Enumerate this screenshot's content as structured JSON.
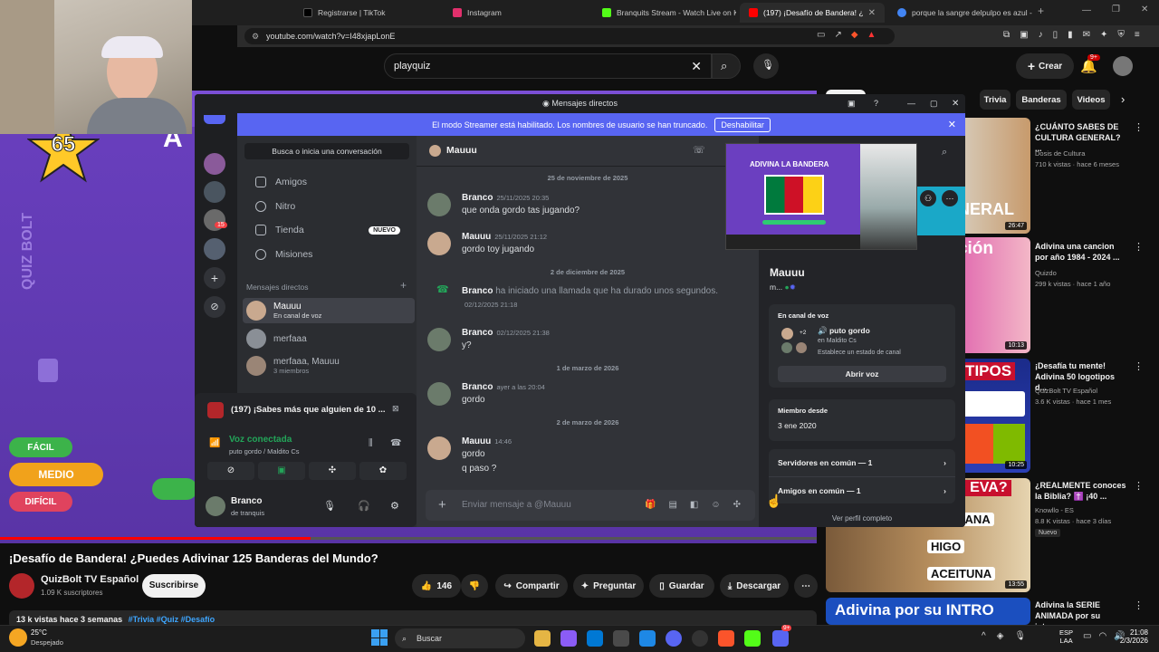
{
  "browser": {
    "tabs": [
      {
        "label": "Registrarse | TikTok",
        "color": "#000000"
      },
      {
        "label": "Instagram",
        "color": "#e1306c"
      },
      {
        "label": "Branquits Stream - Watch Live on Ki",
        "color": "#53fc18"
      },
      {
        "label": "(197) ¡Desafío de Bandera! ¿Pue",
        "color": "#ff0000"
      },
      {
        "label": "porque la sangre delpulpo es azul -",
        "color": "#4285f4"
      }
    ],
    "url": "youtube.com/watch?v=I48xjapLonE"
  },
  "youtube": {
    "search_value": "playquiz",
    "create_label": "Crear",
    "notif_count": "9+",
    "video": {
      "score": "65",
      "brand": "QUIZ BOLT",
      "buttons": [
        "FÁCIL",
        "MEDIO",
        "DIFÍCIL"
      ]
    },
    "title": "¡Desafío de Bandera! ¿Puedes Adivinar 125 Banderas del Mundo?",
    "channel": "QuizBolt TV Español",
    "subscribers": "1.09 K suscriptores",
    "subscribe_label": "Suscribirse",
    "likes": "146",
    "share_label": "Compartir",
    "ask_label": "Preguntar",
    "save_label": "Guardar",
    "download_label": "Descargar",
    "description_meta": "13 k vistas  hace 3 semanas",
    "description_tags": "#Trivia #Quiz #Desafío",
    "chips": [
      "Trivia",
      "Banderas",
      "Videos"
    ],
    "recommendations": [
      {
        "title": "¿CUÁNTO SABES DE CULTURA GENERAL? ...",
        "channel": "Dosis de Cultura",
        "meta": "710 k vistas · hace 6 meses",
        "duration": "26:47",
        "thumb_text": "S GENERAL"
      },
      {
        "title": "Adivina una cancion por año 1984 - 2024 ...",
        "channel": "Quizdo",
        "meta": "299 k vistas · hace 1 año",
        "duration": "10:13",
        "thumb_text": "Canción"
      },
      {
        "title": "¡Desafía tu mente! Adivina 50 logotipos d...",
        "channel": "QuizBolt TV Español",
        "meta": "3.6 K vistas · hace 1 mes",
        "duration": "10:25",
        "thumb_text": "LOGOTIPOS"
      },
      {
        "title": "¿REALMENTE conoces la Biblia? ✝️ ¡40 ...",
        "channel": "Knowllo - ES",
        "meta": "8.8 K vistas · hace 3 días",
        "duration": "13:55",
        "badge": "Nuevo",
        "thumb_text": "¿QUIÓ EVA?",
        "options": [
          "MANZANA",
          "HIGO",
          "ACEITUNA"
        ]
      },
      {
        "title": "Adivina la SERIE ANIMADA por su intro...",
        "channel": "",
        "meta": "",
        "duration": "",
        "thumb_text": "Adivina por su INTRO"
      }
    ]
  },
  "discord": {
    "window_title": "Mensajes directos",
    "banner_text": "El modo Streamer está habilitado. Los nombres de usuario se han truncado.",
    "banner_button": "Deshabilitar",
    "search_placeholder": "Busca o inicia una conversación",
    "nav": [
      "Amigos",
      "Nitro",
      "Tienda",
      "Misiones"
    ],
    "new_badge": "NUEVO",
    "dm_header": "Mensajes directos",
    "server_badge": "15",
    "dms": [
      {
        "name": "Mauuu",
        "status": "En canal de voz"
      },
      {
        "name": "merfaaa",
        "status": ""
      },
      {
        "name": "merfaaa, Mauuu",
        "status": "3 miembros"
      }
    ],
    "voice_panel": {
      "activity": "(197) ¡Sabes más que alguien de 10 ...",
      "status": "Voz conectada",
      "channel": "puto gordo / Maldito Cs"
    },
    "user": {
      "name": "Branco",
      "status": "de tranquis"
    },
    "chat": {
      "recipient": "Mauuu",
      "input_placeholder": "Enviar mensaje a @Mauuu",
      "dividers": [
        "25 de noviembre de 2025",
        "2 de diciembre de 2025",
        "1 de marzo de 2026",
        "2 de marzo de 2026"
      ],
      "messages": [
        {
          "author": "Branco",
          "time": "25/11/2025 20:35",
          "lines": [
            "que onda gordo tas jugando?"
          ]
        },
        {
          "author": "Mauuu",
          "time": "25/11/2025 21:12",
          "lines": [
            "gordo toy jugando"
          ]
        },
        {
          "author": "Branco",
          "call_text": "ha iniciado una llamada que ha durado unos segundos.",
          "time": "02/12/2025 21:18"
        },
        {
          "author": "Branco",
          "time": "02/12/2025 21:38",
          "lines": [
            "y?"
          ]
        },
        {
          "author": "Branco",
          "time": "ayer a las 20:04",
          "lines": [
            "gordo"
          ]
        },
        {
          "author": "Mauuu",
          "time": "14:46",
          "lines": [
            "gordo",
            "q paso ?"
          ]
        }
      ]
    },
    "profile": {
      "name": "Mauuu",
      "tag": "m...",
      "voice_header": "En canal de voz",
      "voice_channel": "puto gordo",
      "voice_server": "en Maldito Cs",
      "voice_extra": "+2",
      "voice_status": "Establece un estado de canal",
      "join_label": "Abrir voz",
      "member_since_label": "Miembro desde",
      "member_since": "3 ene 2020",
      "servers_common": "Servidores en común — 1",
      "friends_common": "Amigos en común — 1",
      "full_profile": "Ver perfil completo"
    },
    "pip_title": "ADIVINA LA BANDERA"
  },
  "taskbar": {
    "weather_temp": "25°C",
    "weather_desc": "Despejado",
    "search_label": "Buscar",
    "lang": "ESP",
    "lang2": "LAA",
    "time": "21:08",
    "date": "2/3/2026",
    "discord_badge": "9+"
  },
  "colors": {
    "youtube_red": "#ff0000",
    "discord_blurple": "#5865f2",
    "discord_green": "#23a559"
  }
}
